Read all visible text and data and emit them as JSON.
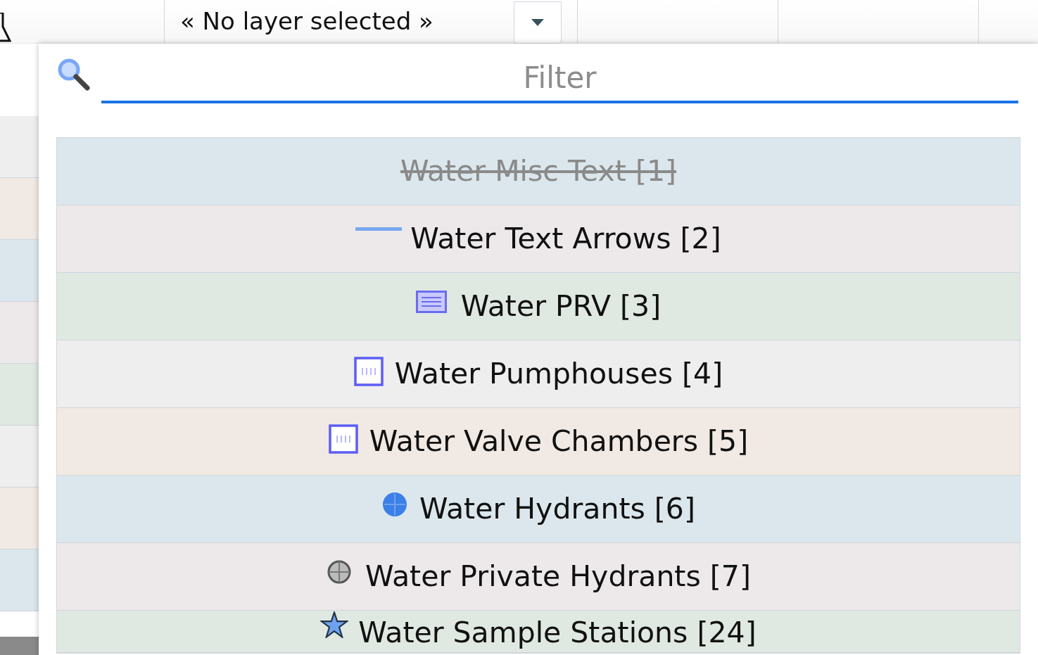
{
  "layer_select": {
    "value": "« No layer selected »"
  },
  "filter": {
    "placeholder": "Filter"
  },
  "layers": [
    {
      "label": "Water Misc Text [1]",
      "kind": "none",
      "disabled": true
    },
    {
      "label": "Water Text Arrows [2]",
      "kind": "line",
      "disabled": false
    },
    {
      "label": "Water PRV [3]",
      "kind": "wide-box",
      "disabled": false
    },
    {
      "label": "Water Pumphouses [4]",
      "kind": "box",
      "disabled": false
    },
    {
      "label": "Water Valve Chambers [5]",
      "kind": "box",
      "disabled": false
    },
    {
      "label": "Water Hydrants [6]",
      "kind": "dot",
      "disabled": false
    },
    {
      "label": "Water Private Hydrants [7]",
      "kind": "ring",
      "disabled": false
    },
    {
      "label": "Water Sample Stations [24]",
      "kind": "star",
      "disabled": false
    }
  ]
}
